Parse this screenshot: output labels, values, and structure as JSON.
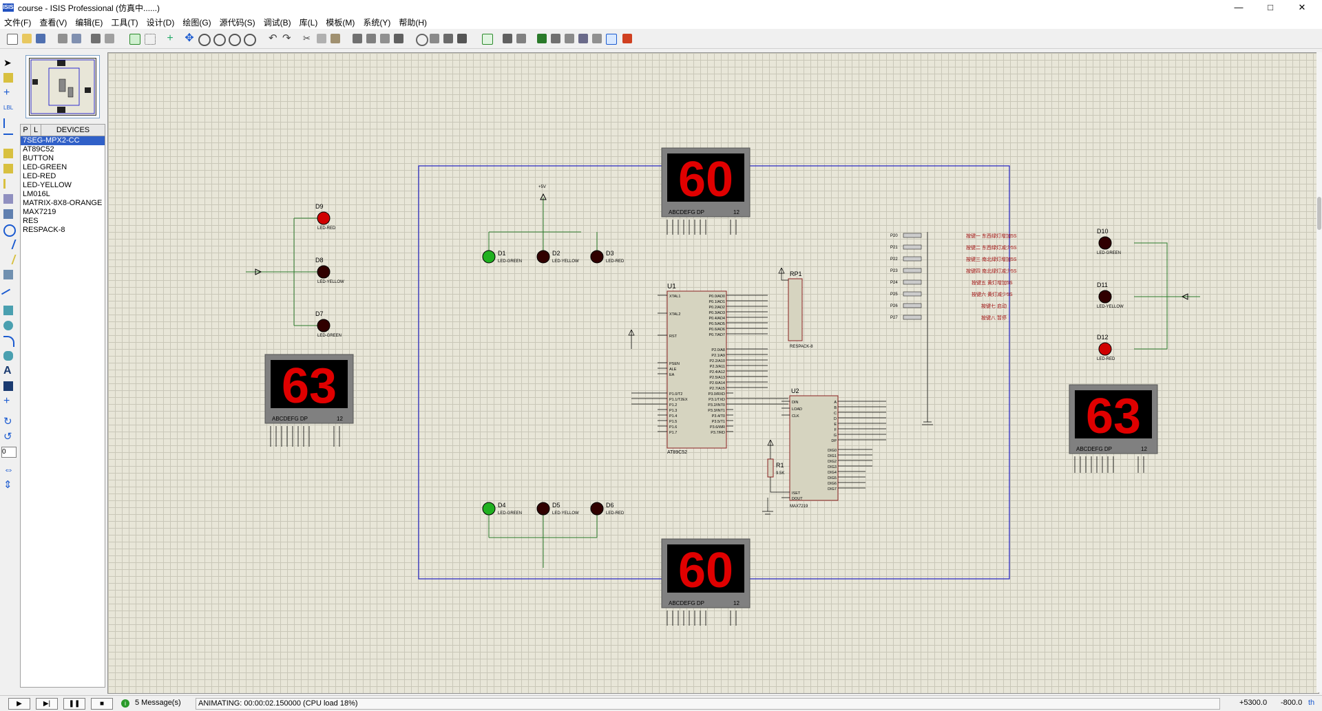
{
  "window": {
    "title": "course - ISIS Professional (仿真中......)",
    "app_icon_text": "ISIS",
    "minimize": "—",
    "maximize": "□",
    "close": "✕"
  },
  "menu": [
    "文件(F)",
    "查看(V)",
    "编辑(E)",
    "工具(T)",
    "设计(D)",
    "绘图(G)",
    "源代码(S)",
    "调试(B)",
    "库(L)",
    "模板(M)",
    "系统(Y)",
    "帮助(H)"
  ],
  "panel": {
    "tab_p": "P",
    "tab_l": "L",
    "devices_label": "DEVICES",
    "devices": [
      "7SEG-MPX2-CC",
      "AT89C52",
      "BUTTON",
      "LED-GREEN",
      "LED-RED",
      "LED-YELLOW",
      "LM016L",
      "MATRIX-8X8-ORANGE",
      "MAX7219",
      "RES",
      "RESPACK-8"
    ],
    "selected_index": 0,
    "rotation_value": "0"
  },
  "schematic": {
    "displays": {
      "top": "60",
      "bottom": "60",
      "left": "63",
      "right": "63",
      "label": "ABCDEFG  DP",
      "pins": "12"
    },
    "leds": {
      "D1": "LED-GREEN",
      "D2": "LED-YELLOW",
      "D3": "LED-RED",
      "D4": "LED-GREEN",
      "D5": "LED-YELLOW",
      "D6": "LED-RED",
      "D7": "LED-GREEN",
      "D8": "LED-YELLOW",
      "D9": "LED-RED",
      "D10": "LED-GREEN",
      "D11": "LED-YELLOW",
      "D12": "LED-RED"
    },
    "text_placeholder": "<TEXT>",
    "power_label": "+5V",
    "u1": {
      "ref": "U1",
      "part": "AT89C52",
      "pins_left": [
        "XTAL1",
        "XTAL2",
        "RST",
        "PSEN",
        "ALE",
        "EA",
        "P1.0/T2",
        "P1.1/T2EX",
        "P1.2",
        "P1.3",
        "P1.4",
        "P1.5",
        "P1.6",
        "P1.7"
      ],
      "pins_right": [
        "P0.0/AD0",
        "P0.1/AD1",
        "P0.2/AD2",
        "P0.3/AD3",
        "P0.4/AD4",
        "P0.5/AD5",
        "P0.6/AD6",
        "P0.7/AD7",
        "P2.0/A8",
        "P2.1/A9",
        "P2.2/A10",
        "P2.3/A11",
        "P2.4/A12",
        "P2.5/A13",
        "P2.6/A14",
        "P2.7/A15",
        "P3.0/RXD",
        "P3.1/TXD",
        "P3.2/INT0",
        "P3.3/INT1",
        "P3.4/T0",
        "P3.5/T1",
        "P3.6/WR",
        "P3.7/RD"
      ]
    },
    "u2": {
      "ref": "U2",
      "part": "MAX7219",
      "pins_left": [
        "DIN",
        "LOAD",
        "CLK",
        "ISET",
        "DOUT"
      ],
      "pins_right": [
        "A",
        "B",
        "C",
        "D",
        "E",
        "F",
        "G",
        "DP",
        "DIG0",
        "DIG1",
        "DIG2",
        "DIG3",
        "DIG4",
        "DIG5",
        "DIG6",
        "DIG7"
      ]
    },
    "rp1": {
      "ref": "RP1",
      "part": "RESPACK-8"
    },
    "r1": {
      "ref": "R1",
      "value": "9.5K"
    },
    "button_notes": [
      "按键一 东西绿灯增加5S",
      "按键二 东西绿灯减少5S",
      "按键三 南北绿灯增加5S",
      "按键四 南北绿灯减少5S",
      "按键五 黄灯增加5S",
      "按键六 黄灯减少5S",
      "按键七 启动",
      "按键八 暂停"
    ],
    "button_ports": [
      "P20",
      "P21",
      "P22",
      "P23",
      "P24",
      "P25",
      "P26",
      "P27"
    ]
  },
  "status": {
    "messages": "5 Message(s)",
    "animating": "ANIMATING: 00:00:02.150000 (CPU load 18%)",
    "x": "+5300.0",
    "y": "-800.0",
    "units": "th"
  }
}
